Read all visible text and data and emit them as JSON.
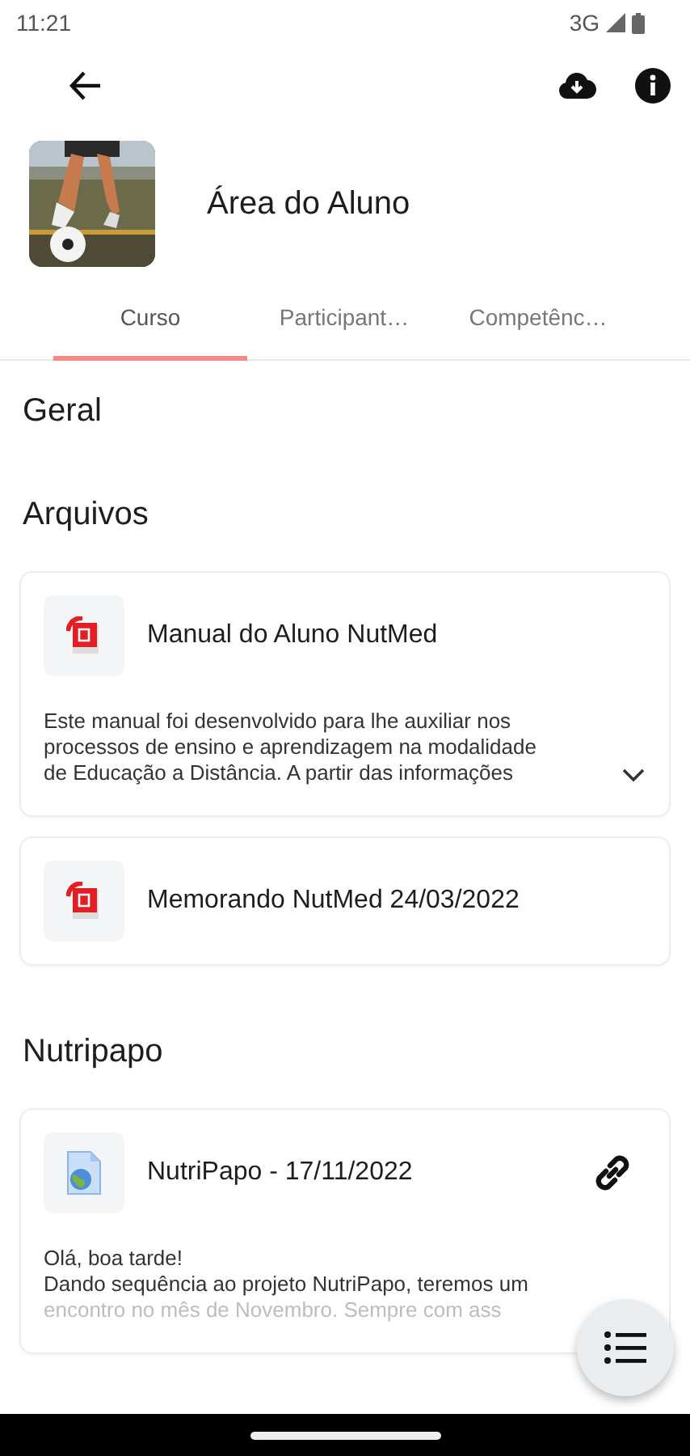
{
  "status_bar": {
    "time": "11:21",
    "network": "3G"
  },
  "app_bar": {
    "title": "Área do Aluno"
  },
  "tabs": [
    {
      "label": "Curso",
      "selected": true
    },
    {
      "label": "Participant…",
      "selected": false
    },
    {
      "label": "Competênc…",
      "selected": false
    }
  ],
  "sections": [
    {
      "title": "Geral"
    },
    {
      "title": "Arquivos",
      "items": [
        {
          "kind": "pdf",
          "title": "Manual do Aluno NutMed",
          "description": [
            "Este manual foi desenvolvido para lhe auxiliar nos",
            "processos de ensino e aprendizagem na modalidade",
            "de Educação a Distância. A partir das informações"
          ],
          "expanded": false
        },
        {
          "kind": "pdf",
          "title": "Memorando NutMed 24/03/2022"
        }
      ]
    },
    {
      "title": "Nutripapo",
      "items": [
        {
          "kind": "url",
          "title": "NutriPapo - 17/11/2022",
          "description": [
            "Olá, boa tarde!",
            "Dando sequência ao projeto NutriPapo, teremos um",
            "encontro no mês de Novembro. Sempre com ass"
          ]
        }
      ]
    }
  ]
}
